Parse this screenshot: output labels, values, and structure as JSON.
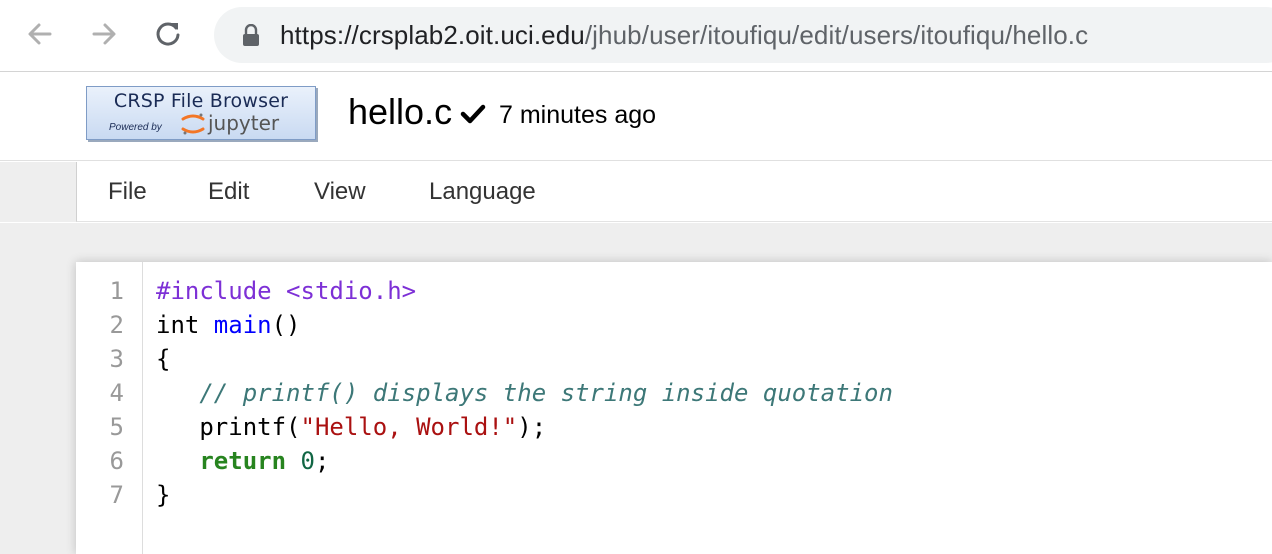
{
  "browser": {
    "url_host": "https://crsplab2.oit.uci.edu",
    "url_path": "/jhub/user/itoufiqu/edit/users/itoufiqu/hello.c"
  },
  "header": {
    "logo_title": "CRSP File Browser",
    "logo_powered": "Powered by",
    "logo_jupyter": "jupyter",
    "filename": "hello.c",
    "saved_status": "7 minutes ago"
  },
  "menu": {
    "items": [
      "File",
      "Edit",
      "View",
      "Language"
    ]
  },
  "editor": {
    "line_numbers": [
      "1",
      "2",
      "3",
      "4",
      "5",
      "6",
      "7"
    ],
    "lines": [
      {
        "tokens": [
          {
            "t": "#include <stdio.h>",
            "c": "meta"
          }
        ]
      },
      {
        "tokens": [
          {
            "t": "int ",
            "c": "plain"
          },
          {
            "t": "main",
            "c": "def"
          },
          {
            "t": "()",
            "c": "plain"
          }
        ]
      },
      {
        "tokens": [
          {
            "t": "{",
            "c": "plain"
          }
        ]
      },
      {
        "tokens": [
          {
            "t": "   ",
            "c": "plain"
          },
          {
            "t": "// printf() displays the string inside quotation",
            "c": "comment"
          }
        ]
      },
      {
        "tokens": [
          {
            "t": "   printf(",
            "c": "plain"
          },
          {
            "t": "\"Hello, World!\"",
            "c": "string"
          },
          {
            "t": ");",
            "c": "plain"
          }
        ]
      },
      {
        "tokens": [
          {
            "t": "   ",
            "c": "plain"
          },
          {
            "t": "return",
            "c": "keyword"
          },
          {
            "t": " ",
            "c": "plain"
          },
          {
            "t": "0",
            "c": "number"
          },
          {
            "t": ";",
            "c": "plain"
          }
        ]
      },
      {
        "tokens": [
          {
            "t": "}",
            "c": "plain"
          }
        ]
      }
    ]
  },
  "icons": {
    "back": "back-arrow-icon",
    "forward": "forward-arrow-icon",
    "reload": "reload-icon",
    "lock": "lock-icon",
    "saved": "checkmark-icon",
    "jupyter": "jupyter-logo-icon"
  },
  "colors": {
    "meta": "#7d30d6",
    "def": "#0000ff",
    "comment": "#3d7878",
    "string": "#aa1111",
    "keyword": "#27841f",
    "number": "#116644"
  }
}
